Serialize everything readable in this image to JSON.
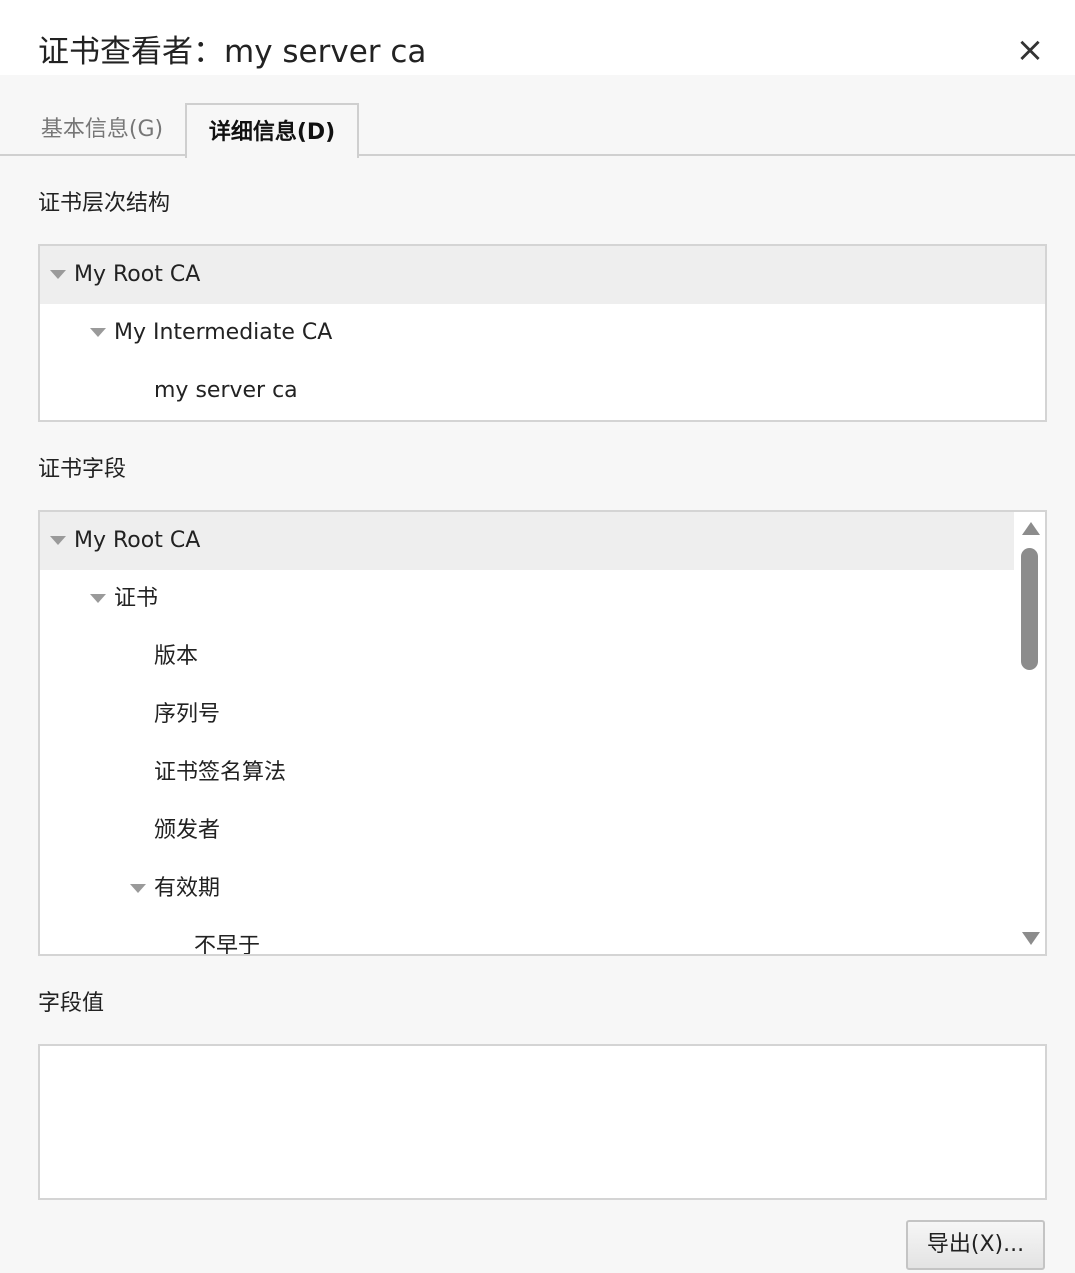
{
  "dialog": {
    "title": "证书查看者：my server ca",
    "close_icon": "×"
  },
  "tabs": [
    {
      "label": "基本信息(G)",
      "active": false
    },
    {
      "label": "详细信息(D)",
      "active": true
    }
  ],
  "hierarchy": {
    "label": "证书层次结构",
    "items": [
      {
        "label": "My Root CA",
        "level": 0,
        "expanded": true,
        "selected": true
      },
      {
        "label": "My Intermediate CA",
        "level": 1,
        "expanded": true,
        "selected": false
      },
      {
        "label": "my server ca",
        "level": 2,
        "expanded": false,
        "selected": false
      }
    ]
  },
  "fields": {
    "label": "证书字段",
    "items": [
      {
        "label": "My Root CA",
        "level": 0,
        "expanded": true,
        "selected": true
      },
      {
        "label": "证书",
        "level": 1,
        "expanded": true,
        "selected": false
      },
      {
        "label": "版本",
        "level": 2,
        "expanded": false,
        "selected": false
      },
      {
        "label": "序列号",
        "level": 2,
        "expanded": false,
        "selected": false
      },
      {
        "label": "证书签名算法",
        "level": 2,
        "expanded": false,
        "selected": false
      },
      {
        "label": "颁发者",
        "level": 2,
        "expanded": false,
        "selected": false
      },
      {
        "label": "有效期",
        "level": 2,
        "expanded": true,
        "selected": false
      },
      {
        "label": "不早于",
        "level": 3,
        "expanded": false,
        "selected": false
      }
    ]
  },
  "field_value": {
    "label": "字段值",
    "value": ""
  },
  "buttons": {
    "export_label": "导出(X)..."
  }
}
